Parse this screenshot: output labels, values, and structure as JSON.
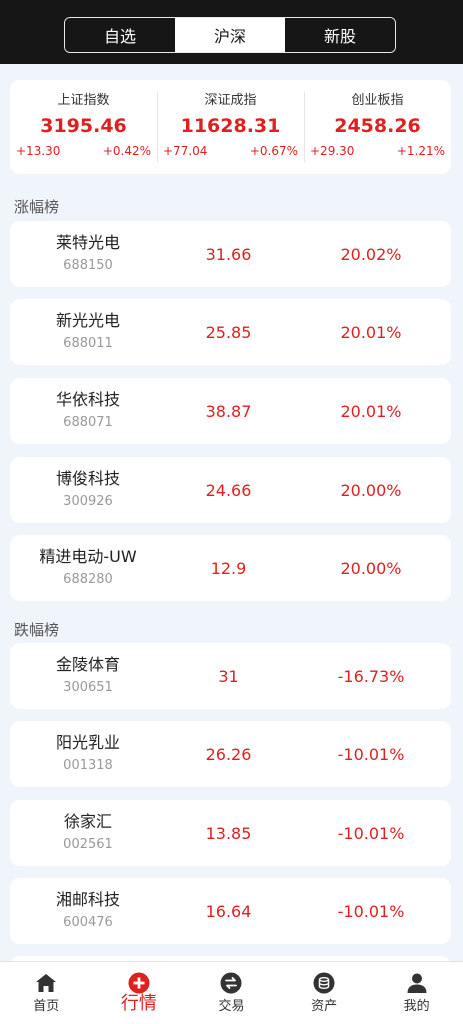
{
  "header": {
    "tabs": [
      {
        "label": "自选"
      },
      {
        "label": "沪深"
      },
      {
        "label": "新股"
      }
    ],
    "active_tab": 1
  },
  "indices": [
    {
      "name": "上证指数",
      "value": "3195.46",
      "change": "+13.30",
      "percent": "+0.42%"
    },
    {
      "name": "深证成指",
      "value": "11628.31",
      "change": "+77.04",
      "percent": "+0.67%"
    },
    {
      "name": "创业板指",
      "value": "2458.26",
      "change": "+29.30",
      "percent": "+1.21%"
    }
  ],
  "gainers": {
    "title": "涨幅榜",
    "items": [
      {
        "name": "莱特光电",
        "code": "688150",
        "price": "31.66",
        "percent": "20.02%"
      },
      {
        "name": "新光光电",
        "code": "688011",
        "price": "25.85",
        "percent": "20.01%"
      },
      {
        "name": "华依科技",
        "code": "688071",
        "price": "38.87",
        "percent": "20.01%"
      },
      {
        "name": "博俊科技",
        "code": "300926",
        "price": "24.66",
        "percent": "20.00%"
      },
      {
        "name": "精进电动-UW",
        "code": "688280",
        "price": "12.9",
        "percent": "20.00%"
      }
    ]
  },
  "losers": {
    "title": "跌幅榜",
    "items": [
      {
        "name": "金陵体育",
        "code": "300651",
        "price": "31",
        "percent": "-16.73%"
      },
      {
        "name": "阳光乳业",
        "code": "001318",
        "price": "26.26",
        "percent": "-10.01%"
      },
      {
        "name": "徐家汇",
        "code": "002561",
        "price": "13.85",
        "percent": "-10.01%"
      },
      {
        "name": "湘邮科技",
        "code": "600476",
        "price": "16.64",
        "percent": "-10.01%"
      }
    ]
  },
  "nav": {
    "items": [
      {
        "label": "首页",
        "icon": "home-icon"
      },
      {
        "label": "行情",
        "icon": "market-icon"
      },
      {
        "label": "交易",
        "icon": "exchange-icon"
      },
      {
        "label": "资产",
        "icon": "assets-icon"
      },
      {
        "label": "我的",
        "icon": "profile-icon"
      }
    ],
    "active_index": 1
  },
  "colors": {
    "rise": "#e02020",
    "header_bg": "#161616",
    "page_bg": "#f0f4fb"
  }
}
